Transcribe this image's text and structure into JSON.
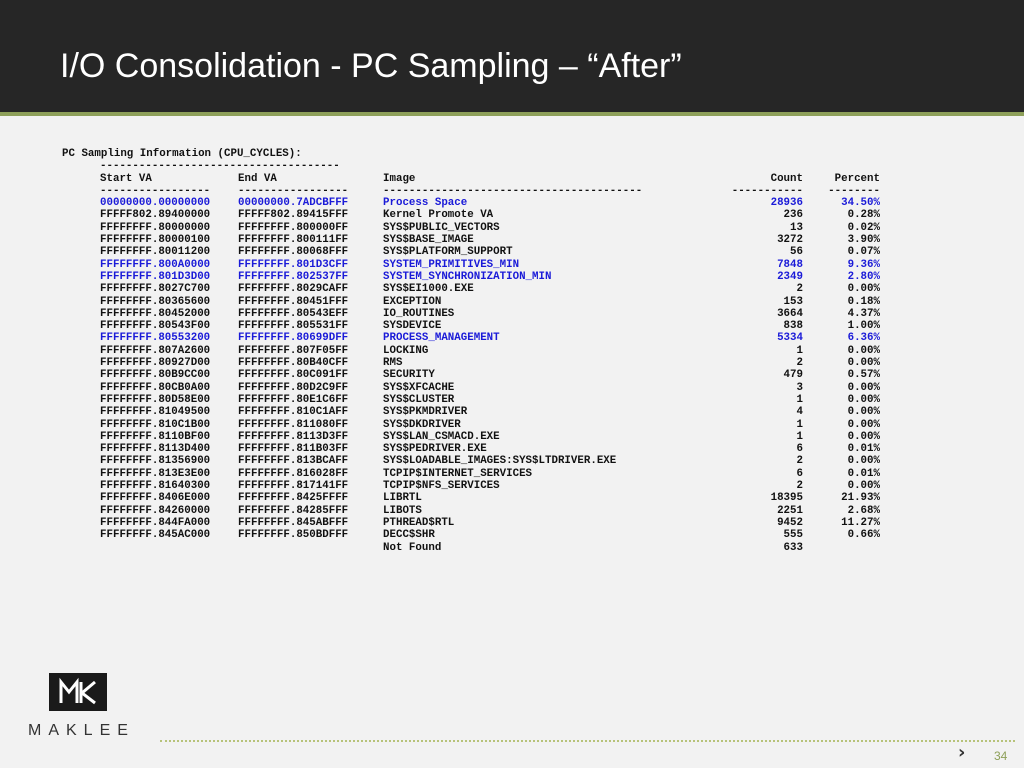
{
  "slide": {
    "title": "I/O Consolidation - PC Sampling – “After”",
    "page_number": "34",
    "next_chevron": "›",
    "brand": "MAKLEE"
  },
  "colors": {
    "header_bg": "#262626",
    "accent": "#8ea05a",
    "highlight_text": "#1a1ad8"
  },
  "report": {
    "heading": "PC Sampling Information (CPU_CYCLES):",
    "heading_rule": "-------------------------------------",
    "columns": {
      "start": "Start VA",
      "end": "End VA",
      "image": "Image",
      "count": "Count",
      "percent": "Percent"
    },
    "rules": {
      "start": "-----------------",
      "end": "-----------------",
      "image": "----------------------------------------",
      "count": "-----------",
      "percent": "--------"
    },
    "rows": [
      {
        "start": "00000000.00000000",
        "end": "00000000.7ADCBFFF",
        "image": "Process Space",
        "count": "28936",
        "percent": "34.50%",
        "highlight": true
      },
      {
        "start": "FFFFF802.89400000",
        "end": "FFFFF802.89415FFF",
        "image": "Kernel Promote VA",
        "count": "236",
        "percent": "0.28%",
        "highlight": false
      },
      {
        "start": "FFFFFFFF.80000000",
        "end": "FFFFFFFF.800000FF",
        "image": "SYS$PUBLIC_VECTORS",
        "count": "13",
        "percent": "0.02%",
        "highlight": false
      },
      {
        "start": "FFFFFFFF.80000100",
        "end": "FFFFFFFF.800111FF",
        "image": "SYS$BASE_IMAGE",
        "count": "3272",
        "percent": "3.90%",
        "highlight": false
      },
      {
        "start": "FFFFFFFF.80011200",
        "end": "FFFFFFFF.80068FFF",
        "image": "SYS$PLATFORM_SUPPORT",
        "count": "56",
        "percent": "0.07%",
        "highlight": false
      },
      {
        "start": "FFFFFFFF.800A0000",
        "end": "FFFFFFFF.801D3CFF",
        "image": "SYSTEM_PRIMITIVES_MIN",
        "count": "7848",
        "percent": "9.36%",
        "highlight": true
      },
      {
        "start": "FFFFFFFF.801D3D00",
        "end": "FFFFFFFF.802537FF",
        "image": "SYSTEM_SYNCHRONIZATION_MIN",
        "count": "2349",
        "percent": "2.80%",
        "highlight": true
      },
      {
        "start": "FFFFFFFF.8027C700",
        "end": "FFFFFFFF.8029CAFF",
        "image": "SYS$EI1000.EXE",
        "count": "2",
        "percent": "0.00%",
        "highlight": false
      },
      {
        "start": "FFFFFFFF.80365600",
        "end": "FFFFFFFF.80451FFF",
        "image": "EXCEPTION",
        "count": "153",
        "percent": "0.18%",
        "highlight": false
      },
      {
        "start": "FFFFFFFF.80452000",
        "end": "FFFFFFFF.80543EFF",
        "image": "IO_ROUTINES",
        "count": "3664",
        "percent": "4.37%",
        "highlight": false
      },
      {
        "start": "FFFFFFFF.80543F00",
        "end": "FFFFFFFF.805531FF",
        "image": "SYSDEVICE",
        "count": "838",
        "percent": "1.00%",
        "highlight": false
      },
      {
        "start": "FFFFFFFF.80553200",
        "end": "FFFFFFFF.80699DFF",
        "image": "PROCESS_MANAGEMENT",
        "count": "5334",
        "percent": "6.36%",
        "highlight": true
      },
      {
        "start": "FFFFFFFF.807A2600",
        "end": "FFFFFFFF.807F05FF",
        "image": "LOCKING",
        "count": "1",
        "percent": "0.00%",
        "highlight": false
      },
      {
        "start": "FFFFFFFF.80927D00",
        "end": "FFFFFFFF.80B40CFF",
        "image": "RMS",
        "count": "2",
        "percent": "0.00%",
        "highlight": false
      },
      {
        "start": "FFFFFFFF.80B9CC00",
        "end": "FFFFFFFF.80C091FF",
        "image": "SECURITY",
        "count": "479",
        "percent": "0.57%",
        "highlight": false
      },
      {
        "start": "FFFFFFFF.80CB0A00",
        "end": "FFFFFFFF.80D2C9FF",
        "image": "SYS$XFCACHE",
        "count": "3",
        "percent": "0.00%",
        "highlight": false
      },
      {
        "start": "FFFFFFFF.80D58E00",
        "end": "FFFFFFFF.80E1C6FF",
        "image": "SYS$CLUSTER",
        "count": "1",
        "percent": "0.00%",
        "highlight": false
      },
      {
        "start": "FFFFFFFF.81049500",
        "end": "FFFFFFFF.810C1AFF",
        "image": "SYS$PKMDRIVER",
        "count": "4",
        "percent": "0.00%",
        "highlight": false
      },
      {
        "start": "FFFFFFFF.810C1B00",
        "end": "FFFFFFFF.811080FF",
        "image": "SYS$DKDRIVER",
        "count": "1",
        "percent": "0.00%",
        "highlight": false
      },
      {
        "start": "FFFFFFFF.8110BF00",
        "end": "FFFFFFFF.8113D3FF",
        "image": "SYS$LAN_CSMACD.EXE",
        "count": "1",
        "percent": "0.00%",
        "highlight": false
      },
      {
        "start": "FFFFFFFF.8113D400",
        "end": "FFFFFFFF.811B03FF",
        "image": "SYS$PEDRIVER.EXE",
        "count": "6",
        "percent": "0.01%",
        "highlight": false
      },
      {
        "start": "FFFFFFFF.81356900",
        "end": "FFFFFFFF.813BCAFF",
        "image": "SYS$LOADABLE_IMAGES:SYS$LTDRIVER.EXE",
        "count": "2",
        "percent": "0.00%",
        "highlight": false
      },
      {
        "start": "FFFFFFFF.813E3E00",
        "end": "FFFFFFFF.816028FF",
        "image": "TCPIP$INTERNET_SERVICES",
        "count": "6",
        "percent": "0.01%",
        "highlight": false
      },
      {
        "start": "FFFFFFFF.81640300",
        "end": "FFFFFFFF.817141FF",
        "image": "TCPIP$NFS_SERVICES",
        "count": "2",
        "percent": "0.00%",
        "highlight": false
      },
      {
        "start": "FFFFFFFF.8406E000",
        "end": "FFFFFFFF.8425FFFF",
        "image": "LIBRTL",
        "count": "18395",
        "percent": "21.93%",
        "highlight": false
      },
      {
        "start": "FFFFFFFF.84260000",
        "end": "FFFFFFFF.84285FFF",
        "image": "LIBOTS",
        "count": "2251",
        "percent": "2.68%",
        "highlight": false
      },
      {
        "start": "FFFFFFFF.844FA000",
        "end": "FFFFFFFF.845ABFFF",
        "image": "PTHREAD$RTL",
        "count": "9452",
        "percent": "11.27%",
        "highlight": false
      },
      {
        "start": "FFFFFFFF.845AC000",
        "end": "FFFFFFFF.850BDFFF",
        "image": "DECC$SHR",
        "count": "555",
        "percent": "0.66%",
        "highlight": false
      },
      {
        "start": "",
        "end": "",
        "image": "Not Found",
        "count": "633",
        "percent": "",
        "highlight": false
      }
    ]
  }
}
